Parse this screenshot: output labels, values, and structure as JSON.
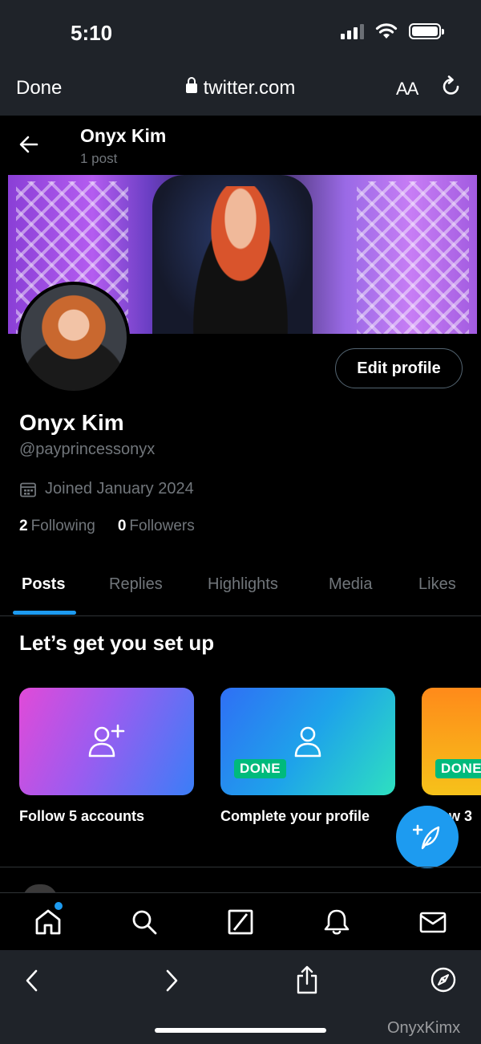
{
  "status_bar": {
    "time": "5:10"
  },
  "browser": {
    "done_label": "Done",
    "url": "twitter.com",
    "text_size_label": "AA"
  },
  "header": {
    "name": "Onyx Kim",
    "post_count": "1 post"
  },
  "profile": {
    "name": "Onyx Kim",
    "handle": "@payprincessonyx",
    "joined": "Joined January 2024",
    "following_count": "2",
    "following_label": "Following",
    "followers_count": "0",
    "followers_label": "Followers",
    "edit_label": "Edit profile"
  },
  "tabs": [
    {
      "label": "Posts",
      "active": true
    },
    {
      "label": "Replies",
      "active": false
    },
    {
      "label": "Highlights",
      "active": false
    },
    {
      "label": "Media",
      "active": false
    },
    {
      "label": "Likes",
      "active": false
    }
  ],
  "setup": {
    "title": "Let’s get you set up",
    "cards": [
      {
        "label": "Follow 5 accounts",
        "badge": "",
        "icon": "add-user-icon"
      },
      {
        "label": "Complete your profile",
        "badge": "DONE",
        "icon": "user-icon"
      },
      {
        "label": "w 3",
        "badge": "DONE",
        "icon": ""
      }
    ]
  },
  "bottom_nav": [
    "home-icon",
    "search-icon",
    "grok-icon",
    "notifications-icon",
    "messages-icon"
  ],
  "watermark": "OnyxKimx",
  "colors": {
    "accent": "#1d9bf0",
    "done_badge": "#00ba7c",
    "chrome": "#1f2329"
  }
}
